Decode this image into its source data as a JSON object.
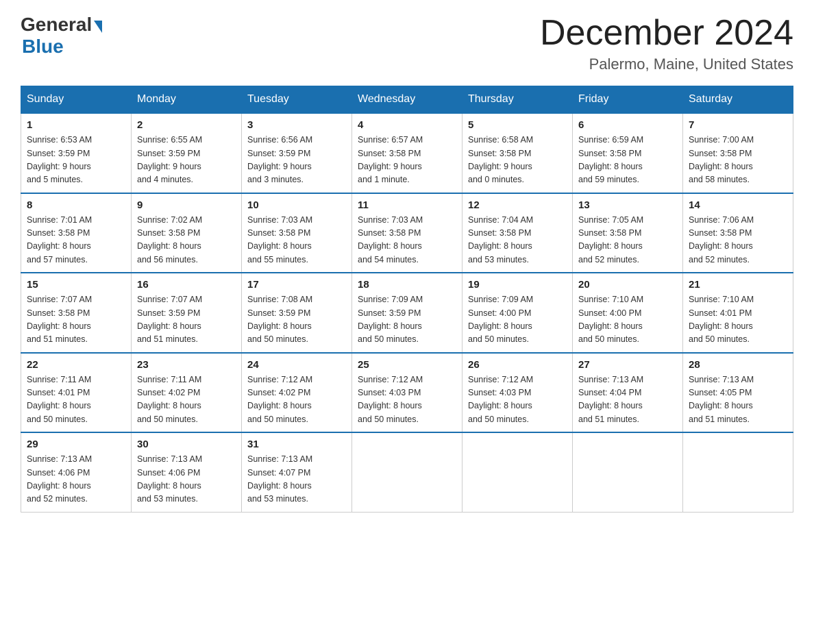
{
  "logo": {
    "text_general": "General",
    "text_blue": "Blue"
  },
  "title": {
    "month": "December 2024",
    "location": "Palermo, Maine, United States"
  },
  "weekdays": [
    "Sunday",
    "Monday",
    "Tuesday",
    "Wednesday",
    "Thursday",
    "Friday",
    "Saturday"
  ],
  "weeks": [
    [
      {
        "day": "1",
        "sunrise": "6:53 AM",
        "sunset": "3:59 PM",
        "daylight": "9 hours and 5 minutes."
      },
      {
        "day": "2",
        "sunrise": "6:55 AM",
        "sunset": "3:59 PM",
        "daylight": "9 hours and 4 minutes."
      },
      {
        "day": "3",
        "sunrise": "6:56 AM",
        "sunset": "3:59 PM",
        "daylight": "9 hours and 3 minutes."
      },
      {
        "day": "4",
        "sunrise": "6:57 AM",
        "sunset": "3:58 PM",
        "daylight": "9 hours and 1 minute."
      },
      {
        "day": "5",
        "sunrise": "6:58 AM",
        "sunset": "3:58 PM",
        "daylight": "9 hours and 0 minutes."
      },
      {
        "day": "6",
        "sunrise": "6:59 AM",
        "sunset": "3:58 PM",
        "daylight": "8 hours and 59 minutes."
      },
      {
        "day": "7",
        "sunrise": "7:00 AM",
        "sunset": "3:58 PM",
        "daylight": "8 hours and 58 minutes."
      }
    ],
    [
      {
        "day": "8",
        "sunrise": "7:01 AM",
        "sunset": "3:58 PM",
        "daylight": "8 hours and 57 minutes."
      },
      {
        "day": "9",
        "sunrise": "7:02 AM",
        "sunset": "3:58 PM",
        "daylight": "8 hours and 56 minutes."
      },
      {
        "day": "10",
        "sunrise": "7:03 AM",
        "sunset": "3:58 PM",
        "daylight": "8 hours and 55 minutes."
      },
      {
        "day": "11",
        "sunrise": "7:03 AM",
        "sunset": "3:58 PM",
        "daylight": "8 hours and 54 minutes."
      },
      {
        "day": "12",
        "sunrise": "7:04 AM",
        "sunset": "3:58 PM",
        "daylight": "8 hours and 53 minutes."
      },
      {
        "day": "13",
        "sunrise": "7:05 AM",
        "sunset": "3:58 PM",
        "daylight": "8 hours and 52 minutes."
      },
      {
        "day": "14",
        "sunrise": "7:06 AM",
        "sunset": "3:58 PM",
        "daylight": "8 hours and 52 minutes."
      }
    ],
    [
      {
        "day": "15",
        "sunrise": "7:07 AM",
        "sunset": "3:58 PM",
        "daylight": "8 hours and 51 minutes."
      },
      {
        "day": "16",
        "sunrise": "7:07 AM",
        "sunset": "3:59 PM",
        "daylight": "8 hours and 51 minutes."
      },
      {
        "day": "17",
        "sunrise": "7:08 AM",
        "sunset": "3:59 PM",
        "daylight": "8 hours and 50 minutes."
      },
      {
        "day": "18",
        "sunrise": "7:09 AM",
        "sunset": "3:59 PM",
        "daylight": "8 hours and 50 minutes."
      },
      {
        "day": "19",
        "sunrise": "7:09 AM",
        "sunset": "4:00 PM",
        "daylight": "8 hours and 50 minutes."
      },
      {
        "day": "20",
        "sunrise": "7:10 AM",
        "sunset": "4:00 PM",
        "daylight": "8 hours and 50 minutes."
      },
      {
        "day": "21",
        "sunrise": "7:10 AM",
        "sunset": "4:01 PM",
        "daylight": "8 hours and 50 minutes."
      }
    ],
    [
      {
        "day": "22",
        "sunrise": "7:11 AM",
        "sunset": "4:01 PM",
        "daylight": "8 hours and 50 minutes."
      },
      {
        "day": "23",
        "sunrise": "7:11 AM",
        "sunset": "4:02 PM",
        "daylight": "8 hours and 50 minutes."
      },
      {
        "day": "24",
        "sunrise": "7:12 AM",
        "sunset": "4:02 PM",
        "daylight": "8 hours and 50 minutes."
      },
      {
        "day": "25",
        "sunrise": "7:12 AM",
        "sunset": "4:03 PM",
        "daylight": "8 hours and 50 minutes."
      },
      {
        "day": "26",
        "sunrise": "7:12 AM",
        "sunset": "4:03 PM",
        "daylight": "8 hours and 50 minutes."
      },
      {
        "day": "27",
        "sunrise": "7:13 AM",
        "sunset": "4:04 PM",
        "daylight": "8 hours and 51 minutes."
      },
      {
        "day": "28",
        "sunrise": "7:13 AM",
        "sunset": "4:05 PM",
        "daylight": "8 hours and 51 minutes."
      }
    ],
    [
      {
        "day": "29",
        "sunrise": "7:13 AM",
        "sunset": "4:06 PM",
        "daylight": "8 hours and 52 minutes."
      },
      {
        "day": "30",
        "sunrise": "7:13 AM",
        "sunset": "4:06 PM",
        "daylight": "8 hours and 53 minutes."
      },
      {
        "day": "31",
        "sunrise": "7:13 AM",
        "sunset": "4:07 PM",
        "daylight": "8 hours and 53 minutes."
      },
      null,
      null,
      null,
      null
    ]
  ],
  "labels": {
    "sunrise": "Sunrise:",
    "sunset": "Sunset:",
    "daylight": "Daylight:"
  }
}
